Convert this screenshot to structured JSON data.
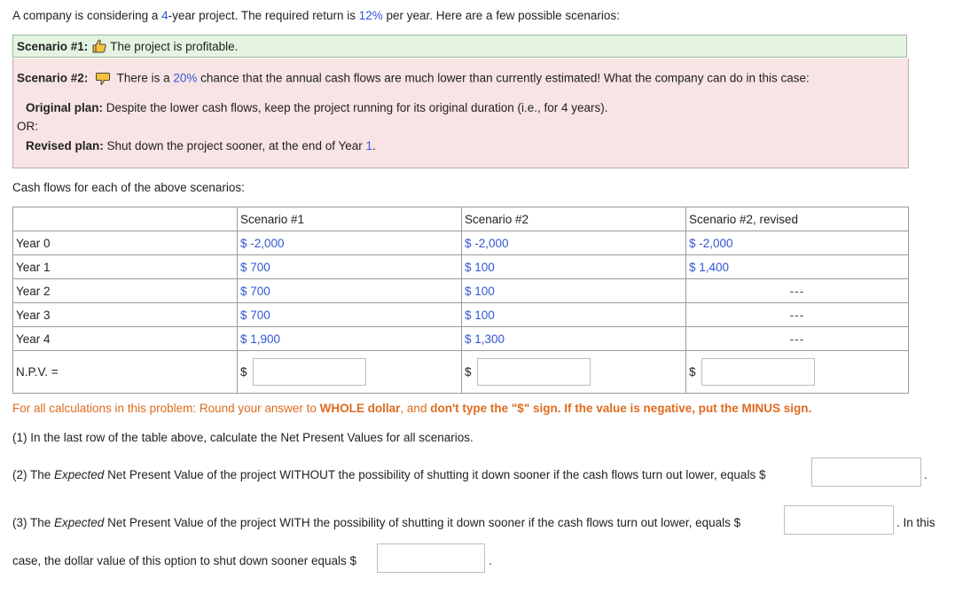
{
  "intro": {
    "a": "A company is considering a ",
    "years": "4",
    "b": "-year project. The required return is ",
    "rate": "12%",
    "c": " per year. Here are a few possible scenarios:"
  },
  "scenario1": {
    "label": "Scenario #1:",
    "icon": "thumbs-up-icon",
    "text": "The project is profitable.",
    "bg": "#e4f4e1"
  },
  "scenario2": {
    "label": "Scenario #2:",
    "icon": "thumbs-down-icon",
    "a": "There is a ",
    "pct": "20%",
    "b": " chance that the annual cash flows are much lower than currently estimated! What the company can do in this case:",
    "original_label": "Original plan:",
    "original_text": " Despite the lower cash flows, keep the project running for its original duration (i.e., for 4 years).",
    "or": "OR:",
    "revised_label": "Revised plan:",
    "revised_text": " Shut down the project sooner, at the end of Year ",
    "revised_year": "1",
    "revised_end": ".",
    "bg": "#f8e4e4"
  },
  "cashflows_label": "Cash flows for each of the above scenarios:",
  "table": {
    "headers": [
      "",
      "Scenario #1",
      "Scenario #2",
      "Scenario #2, revised"
    ],
    "rows": [
      [
        "Year 0",
        "$ -2,000",
        "$ -2,000",
        "$ -2,000"
      ],
      [
        "Year 1",
        "$ 700",
        "$ 100",
        "$ 1,400"
      ],
      [
        "Year 2",
        "$ 700",
        "$ 100",
        "---"
      ],
      [
        "Year 3",
        "$ 700",
        "$ 100",
        "---"
      ],
      [
        "Year 4",
        "$ 1,900",
        "$ 1,300",
        "---"
      ]
    ],
    "npv_label": "N.P.V. =",
    "dollar": "$",
    "npv_values": [
      "",
      "",
      ""
    ]
  },
  "instructions": {
    "a": "For all calculations in this problem: Round your answer to ",
    "b": "WHOLE dollar",
    "c": ", and ",
    "d": "don't type the \"$\" sign.",
    "e": " If the value is negative, put the MINUS sign."
  },
  "q1": "(1) In the last row of the table above, calculate the Net Present Values for all scenarios.",
  "q2": {
    "a": "(2) The ",
    "exp": "Expected",
    "b": " Net Present Value of the project WITHOUT the possibility of shutting it down sooner if the cash flows turn out lower, equals $",
    "value": "",
    "end": "."
  },
  "q3": {
    "a": "(3) The ",
    "exp": "Expected",
    "b": " Net Present Value of the project WITH the possibility of shutting it down sooner if the cash flows turn out lower, equals $",
    "value": "",
    "after": ". In this",
    "line2": "case, the dollar value of this option to shut down sooner equals $",
    "option_value": "",
    "end": "."
  }
}
